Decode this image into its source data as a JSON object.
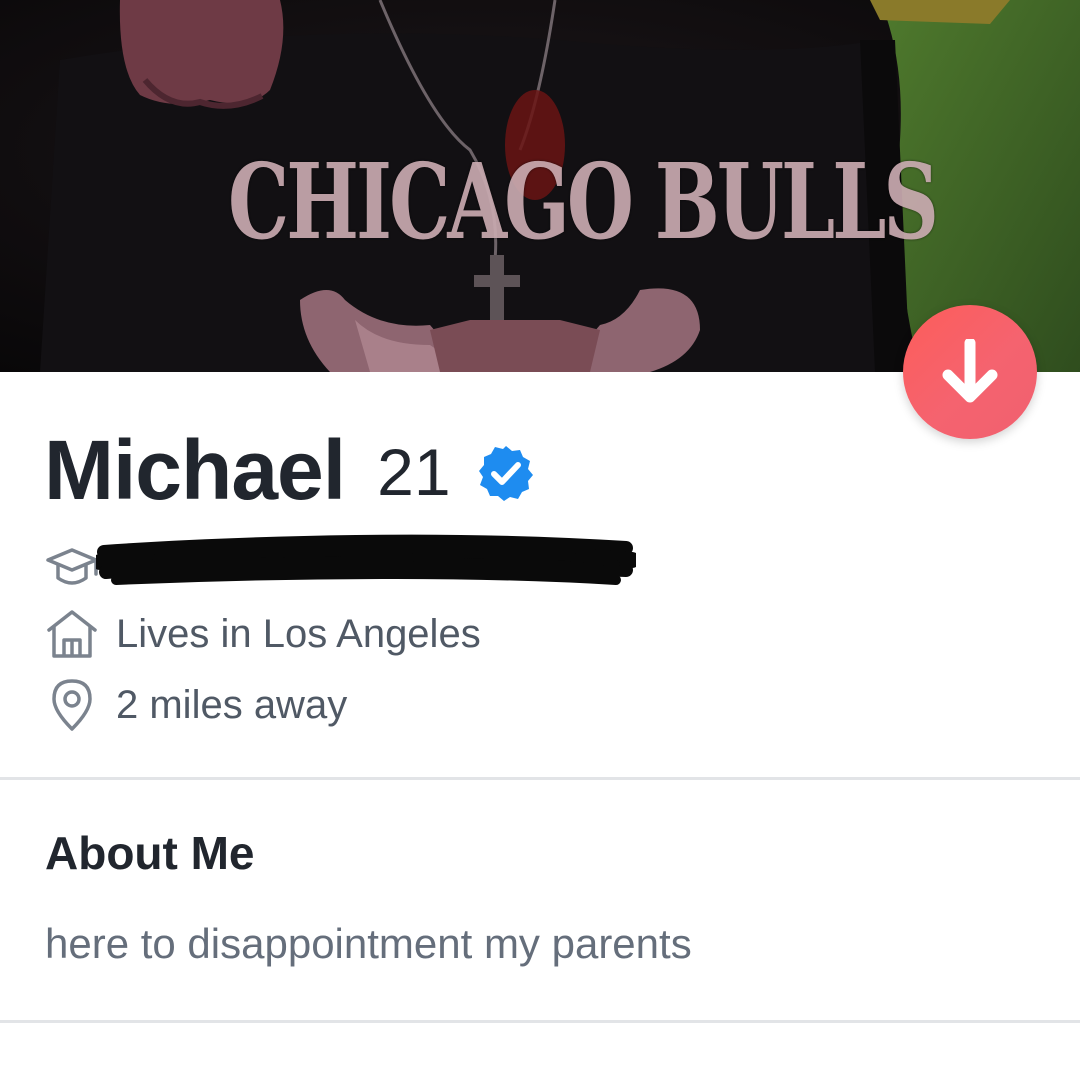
{
  "profile_photo": {
    "shirt_text": "CHICAGO BULLS"
  },
  "actions": {
    "collapse_icon": "arrow-down-icon",
    "collapse_color": "#f8626a"
  },
  "profile": {
    "name": "Michael",
    "age": "21",
    "verified_icon": "verified-badge-icon",
    "verified_color": "#1e8cf0"
  },
  "details": {
    "school_icon": "graduation-cap-icon",
    "school": "",
    "home_icon": "home-icon",
    "lives_in": "Lives in Los Angeles",
    "location_icon": "location-pin-icon",
    "distance": "2 miles away"
  },
  "about": {
    "title": "About Me",
    "bio": "here to disappointment my parents"
  }
}
